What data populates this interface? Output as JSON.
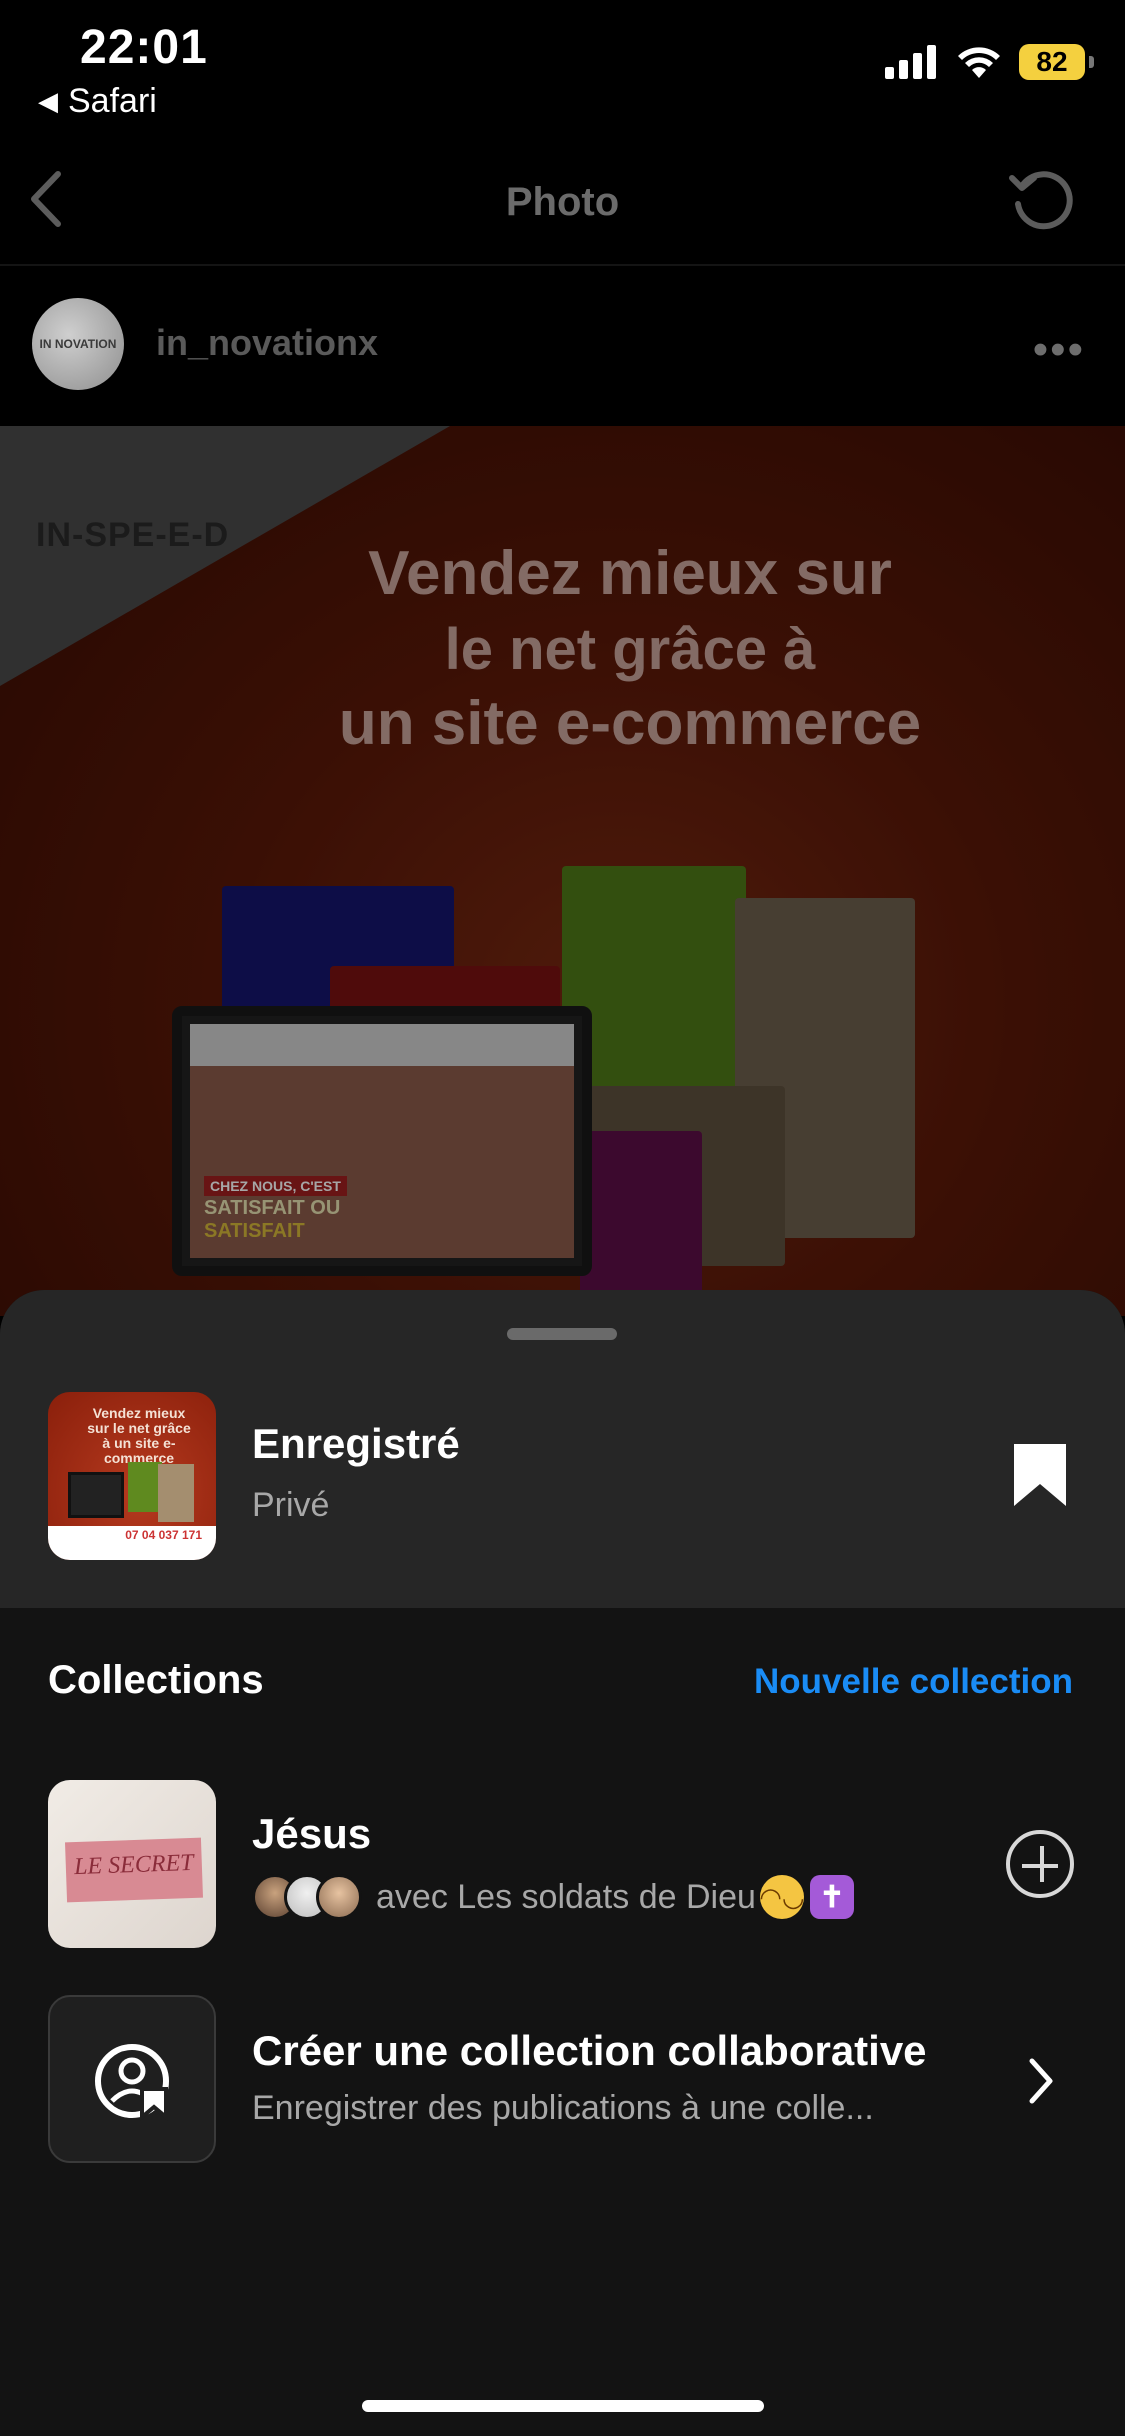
{
  "status_bar": {
    "time": "22:01",
    "back_app": "Safari",
    "battery": "82",
    "icons": [
      "signal-icon",
      "wifi-icon",
      "battery-icon"
    ]
  },
  "header": {
    "title": "Photo",
    "back_icon": "chevron-left-icon",
    "refresh_icon": "refresh-icon"
  },
  "post": {
    "username": "in_novationx",
    "avatar_text": "IN NOVATION",
    "more_icon": "more-dots-icon",
    "brand_logo": "IN-SPE-E-D",
    "headline": [
      "Vendez mieux sur",
      "le net grâce à",
      "un site e-commerce"
    ],
    "screen_promo": [
      "CHEZ NOUS, C'EST",
      "SATISFAIT OU",
      "SATISFAIT"
    ]
  },
  "sheet": {
    "saved_title": "Enregistré",
    "saved_subtitle": "Privé",
    "bookmark_icon": "bookmark-filled-icon",
    "thumb_text": "Vendez mieux sur le net grâce à un site e-commerce",
    "thumb_phone": "07 04 037 171",
    "collections_label": "Collections",
    "new_collection": "Nouvelle collection",
    "collections": [
      {
        "name": "Jésus",
        "meta": "avec Les soldats de Dieu",
        "tile_text": "LE SECRET",
        "action_icon": "plus-circle-icon"
      },
      {
        "name": "Créer une collection collaborative",
        "meta": "Enregistrer des publications à une colle...",
        "tile_icon": "collab-user-bookmark-icon",
        "action_icon": "chevron-right-icon"
      }
    ]
  },
  "colors": {
    "accent": "#1a8cf5",
    "sheet_bg": "#131313",
    "sheet_top_bg": "#262626",
    "battery": "#f4d03f"
  }
}
